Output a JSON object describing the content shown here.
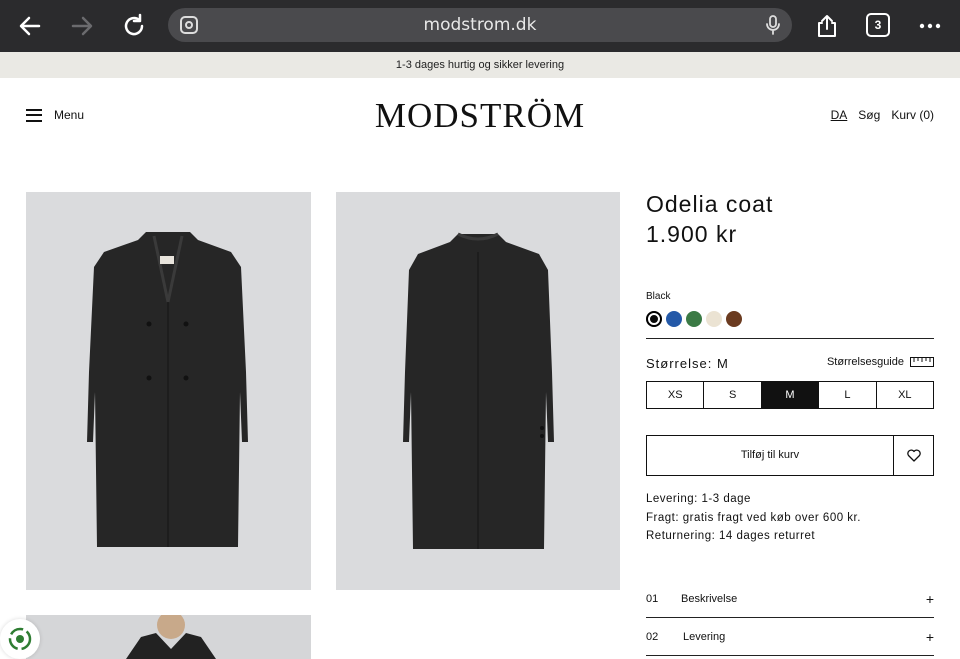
{
  "browser": {
    "url": "modstrom.dk",
    "tab_count": "3"
  },
  "banner": {
    "text": "1-3 dages hurtig og sikker levering"
  },
  "header": {
    "menu_label": "Menu",
    "logo": "MODSTRÖM",
    "lang": "DA",
    "search": "Søg",
    "cart": "Kurv (0)"
  },
  "product": {
    "name": "Odelia coat",
    "price": "1.900 kr",
    "color_name": "Black",
    "swatches": [
      "#0a0a0a",
      "#2459a8",
      "#3b7a45",
      "#ebe3d3",
      "#6b3b20"
    ],
    "size_label": "Størrelse: M",
    "size_guide": "Størrelsesguide",
    "sizes": [
      "XS",
      "S",
      "M",
      "L",
      "XL"
    ],
    "selected_size": "M",
    "add_to_cart": "Tilføj til kurv",
    "info": {
      "delivery": "Levering: 1-3 dage",
      "shipping": "Fragt: gratis fragt ved køb over 600 kr.",
      "returns": "Returnering: 14 dages returret"
    },
    "accordion": [
      {
        "num": "01",
        "title": "Beskrivelse"
      },
      {
        "num": "02",
        "title": "Levering"
      }
    ]
  }
}
